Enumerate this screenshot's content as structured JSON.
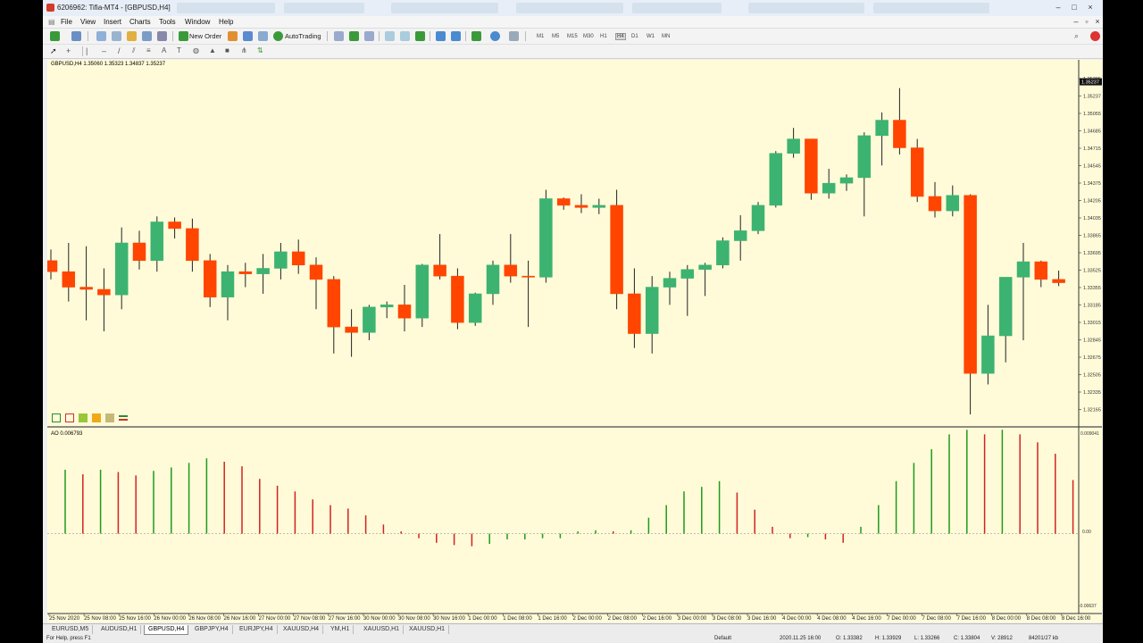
{
  "window": {
    "title": "6206962: Tifia-MT4 - [GBPUSD,H4]"
  },
  "menu": [
    "File",
    "View",
    "Insert",
    "Charts",
    "Tools",
    "Window",
    "Help"
  ],
  "toolbar": {
    "new_order": "New Order",
    "autotrading": "AutoTrading",
    "timeframes": [
      "M1",
      "M5",
      "M15",
      "M30",
      "H1",
      "H4",
      "D1",
      "W1",
      "MN"
    ],
    "active_timeframe": "H4"
  },
  "chart": {
    "header": "GBPUSD,H4  1.35060 1.35323 1.34837 1.35237",
    "background": "#fffbd8",
    "bull_color": "#3cb371",
    "bear_color": "#ff4500",
    "price_labels": [
      "1.35395",
      "1.35237",
      "1.35055",
      "1.34685",
      "1.34715",
      "1.34545",
      "1.34375",
      "1.34205",
      "1.34035",
      "1.33865",
      "1.33695",
      "1.33525",
      "1.33355",
      "1.33185",
      "1.33015",
      "1.32845",
      "1.32675",
      "1.32505",
      "1.32335",
      "1.32165"
    ],
    "current_price": "1.35237"
  },
  "indicator": {
    "label": "AO 0.006793",
    "top_label": "0.009041",
    "zero_label": "0.00",
    "bottom_label": "-0.00637"
  },
  "chart_data": [
    {
      "type": "candlestick",
      "title": "GBPUSD,H4",
      "ylim": [
        1.32165,
        1.35395
      ],
      "up_color": "#3cb371",
      "down_color": "#ff4500",
      "ohlc": [
        [
          1.3362,
          1.3372,
          1.3345,
          1.3352
        ],
        [
          1.3352,
          1.3378,
          1.3325,
          1.3338
        ],
        [
          1.3338,
          1.3375,
          1.3308,
          1.3336
        ],
        [
          1.3336,
          1.3355,
          1.3298,
          1.3331
        ],
        [
          1.3331,
          1.3392,
          1.3318,
          1.3378
        ],
        [
          1.3378,
          1.3389,
          1.3354,
          1.3362
        ],
        [
          1.3362,
          1.3402,
          1.3352,
          1.3397
        ],
        [
          1.3397,
          1.3401,
          1.3382,
          1.3391
        ],
        [
          1.3391,
          1.34,
          1.3352,
          1.3362
        ],
        [
          1.3362,
          1.3368,
          1.332,
          1.3329
        ],
        [
          1.3329,
          1.3358,
          1.3308,
          1.3352
        ],
        [
          1.3352,
          1.336,
          1.3338,
          1.335
        ],
        [
          1.335,
          1.3368,
          1.3332,
          1.3355
        ],
        [
          1.3355,
          1.3378,
          1.3345,
          1.337
        ],
        [
          1.337,
          1.3381,
          1.335,
          1.3358
        ],
        [
          1.3358,
          1.3365,
          1.3318,
          1.3345
        ],
        [
          1.3345,
          1.3348,
          1.3278,
          1.3302
        ],
        [
          1.3302,
          1.3318,
          1.3275,
          1.3297
        ],
        [
          1.3297,
          1.3322,
          1.329,
          1.332
        ],
        [
          1.332,
          1.3325,
          1.331,
          1.3322
        ],
        [
          1.3322,
          1.334,
          1.3298,
          1.331
        ],
        [
          1.331,
          1.3359,
          1.3302,
          1.3358
        ],
        [
          1.3358,
          1.3386,
          1.3345,
          1.3348
        ],
        [
          1.3348,
          1.3355,
          1.33,
          1.3306
        ],
        [
          1.3306,
          1.3333,
          1.3303,
          1.3332
        ],
        [
          1.3332,
          1.3362,
          1.3322,
          1.3358
        ],
        [
          1.3358,
          1.3386,
          1.3342,
          1.3348
        ],
        [
          1.3348,
          1.3362,
          1.3302,
          1.3347
        ],
        [
          1.3347,
          1.3426,
          1.3342,
          1.3418
        ],
        [
          1.3418,
          1.3419,
          1.3408,
          1.3412
        ],
        [
          1.3412,
          1.3422,
          1.3405,
          1.341
        ],
        [
          1.341,
          1.3418,
          1.3404,
          1.3412
        ],
        [
          1.3412,
          1.3426,
          1.3318,
          1.3332
        ],
        [
          1.3332,
          1.3355,
          1.3283,
          1.3296
        ],
        [
          1.3296,
          1.3348,
          1.3278,
          1.3338
        ],
        [
          1.3338,
          1.3352,
          1.3322,
          1.3346
        ],
        [
          1.3346,
          1.3358,
          1.3312,
          1.3354
        ],
        [
          1.3354,
          1.336,
          1.333,
          1.3358
        ],
        [
          1.3358,
          1.3383,
          1.3355,
          1.338
        ],
        [
          1.338,
          1.3403,
          1.3362,
          1.3389
        ],
        [
          1.3389,
          1.3415,
          1.3386,
          1.3412
        ],
        [
          1.3412,
          1.3461,
          1.341,
          1.3459
        ],
        [
          1.3459,
          1.3482,
          1.3455,
          1.3472
        ],
        [
          1.3472,
          1.3472,
          1.3417,
          1.3423
        ],
        [
          1.3423,
          1.3445,
          1.3418,
          1.3432
        ],
        [
          1.3432,
          1.344,
          1.3425,
          1.3437
        ],
        [
          1.3437,
          1.3478,
          1.3402,
          1.3475
        ],
        [
          1.3475,
          1.3496,
          1.3448,
          1.3489
        ],
        [
          1.3489,
          1.3518,
          1.3458,
          1.3464
        ],
        [
          1.3464,
          1.3472,
          1.3415,
          1.342
        ],
        [
          1.342,
          1.3433,
          1.3401,
          1.3407
        ],
        [
          1.3407,
          1.343,
          1.3402,
          1.3421
        ],
        [
          1.3421,
          1.3422,
          1.3223,
          1.326
        ],
        [
          1.326,
          1.3322,
          1.325,
          1.3294
        ],
        [
          1.3294,
          1.3344,
          1.327,
          1.3347
        ],
        [
          1.3347,
          1.3378,
          1.329,
          1.3361
        ],
        [
          1.3361,
          1.3362,
          1.3338,
          1.3345
        ],
        [
          1.3345,
          1.3353,
          1.3339,
          1.3342
        ],
        [
          1.3342,
          1.3361,
          1.3315,
          1.3338
        ],
        [
          1.3338,
          1.3344,
          1.3282,
          1.3339
        ],
        [
          1.3339,
          1.3362,
          1.329,
          1.335
        ]
      ]
    },
    {
      "type": "bar",
      "title": "AO",
      "ylim": [
        -0.00637,
        0.009041
      ],
      "values": [
        0.0056,
        0.0052,
        0.0056,
        0.0054,
        0.0051,
        0.0055,
        0.0058,
        0.0062,
        0.0066,
        0.0063,
        0.0059,
        0.0048,
        0.0042,
        0.0037,
        0.003,
        0.0025,
        0.0022,
        0.0016,
        0.0008,
        0.0002,
        -0.0004,
        -0.0008,
        -0.001,
        -0.0011,
        -0.0009,
        -0.0005,
        -0.0005,
        -0.0004,
        -0.0004,
        0.0002,
        0.0003,
        0.0002,
        0.0003,
        0.0014,
        0.0025,
        0.0037,
        0.0041,
        0.0046,
        0.0036,
        0.0021,
        0.0006,
        -0.0004,
        -0.0003,
        -0.0005,
        -0.0008,
        0.0006,
        0.0025,
        0.0046,
        0.0062,
        0.0074,
        0.0087,
        0.0091,
        0.0087,
        0.0091,
        0.0087,
        0.008,
        0.007,
        0.0047,
        -0.0002,
        -0.0034,
        -0.0049,
        -0.0064,
        -0.005,
        -0.0045,
        -0.0047,
        -0.0043
      ]
    }
  ],
  "xaxis_labels": [
    "25 Nov 2020",
    "25 Nov 08:00",
    "25 Nov 16:00",
    "26 Nov 00:00",
    "26 Nov 08:00",
    "26 Nov 16:00",
    "27 Nov 00:00",
    "27 Nov 08:00",
    "27 Nov 16:00",
    "30 Nov 00:00",
    "30 Nov 08:00",
    "30 Nov 16:00",
    "1 Dec 00:00",
    "1 Dec 08:00",
    "1 Dec 16:00",
    "2 Dec 00:00",
    "2 Dec 08:00",
    "2 Dec 16:00",
    "3 Dec 00:00",
    "3 Dec 08:00",
    "3 Dec 16:00",
    "4 Dec 00:00",
    "4 Dec 08:00",
    "4 Dec 16:00",
    "7 Dec 00:00",
    "7 Dec 08:00",
    "7 Dec 16:00",
    "8 Dec 00:00",
    "8 Dec 08:00",
    "8 Dec 16:00"
  ],
  "symbol_tabs": [
    "EURUSD,M5",
    "AUDUSD,H1",
    "GBPUSD,H4",
    "GBPJPY,H4",
    "EURJPY,H4",
    "XAUUSD,H4",
    "YM,H1",
    "XAUUSD,H1",
    "XAUUSD,H1"
  ],
  "active_symbol_tab": "GBPUSD,H4",
  "status": {
    "help": "For Help, press F1",
    "profile": "Default",
    "datetime": "2020.11.25 16:00",
    "open": "O: 1.33382",
    "high": "H: 1.33929",
    "low": "L: 1.33266",
    "close": "C: 1.33804",
    "volume": "V: 28912",
    "traffic": "84201/27 kb"
  }
}
